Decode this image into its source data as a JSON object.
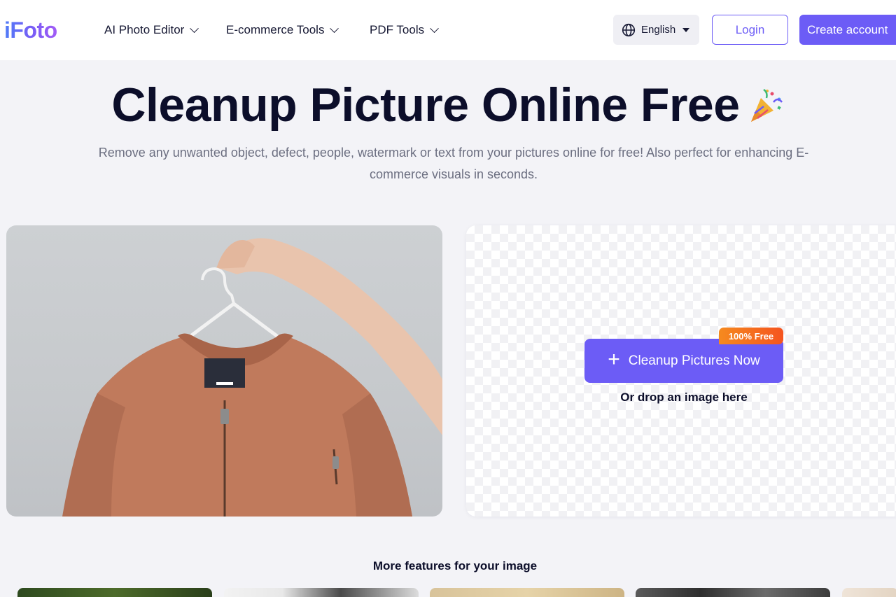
{
  "header": {
    "logo": "iFoto",
    "nav": [
      {
        "label": "AI Photo Editor"
      },
      {
        "label": "E-commerce Tools"
      },
      {
        "label": "PDF Tools"
      }
    ],
    "language": "English",
    "login_label": "Login",
    "create_account_label": "Create account"
  },
  "hero": {
    "title": "Cleanup Picture Online Free",
    "subtitle": "Remove any unwanted object, defect, people, watermark or text from your pictures online for free! Also perfect for enhancing E-commerce visuals in seconds."
  },
  "upload": {
    "button_label": "Cleanup Pictures Now",
    "badge": "100% Free",
    "drop_text": "Or drop an image here"
  },
  "features": {
    "title": "More features for your image"
  },
  "colors": {
    "accent": "#6c5cf6",
    "badge": "#f5701f",
    "title": "#0c0e2a",
    "jacket": "#c07a5c"
  },
  "icons": {
    "globe": "globe-icon",
    "party": "party-popper-icon",
    "plus": "plus-icon"
  }
}
